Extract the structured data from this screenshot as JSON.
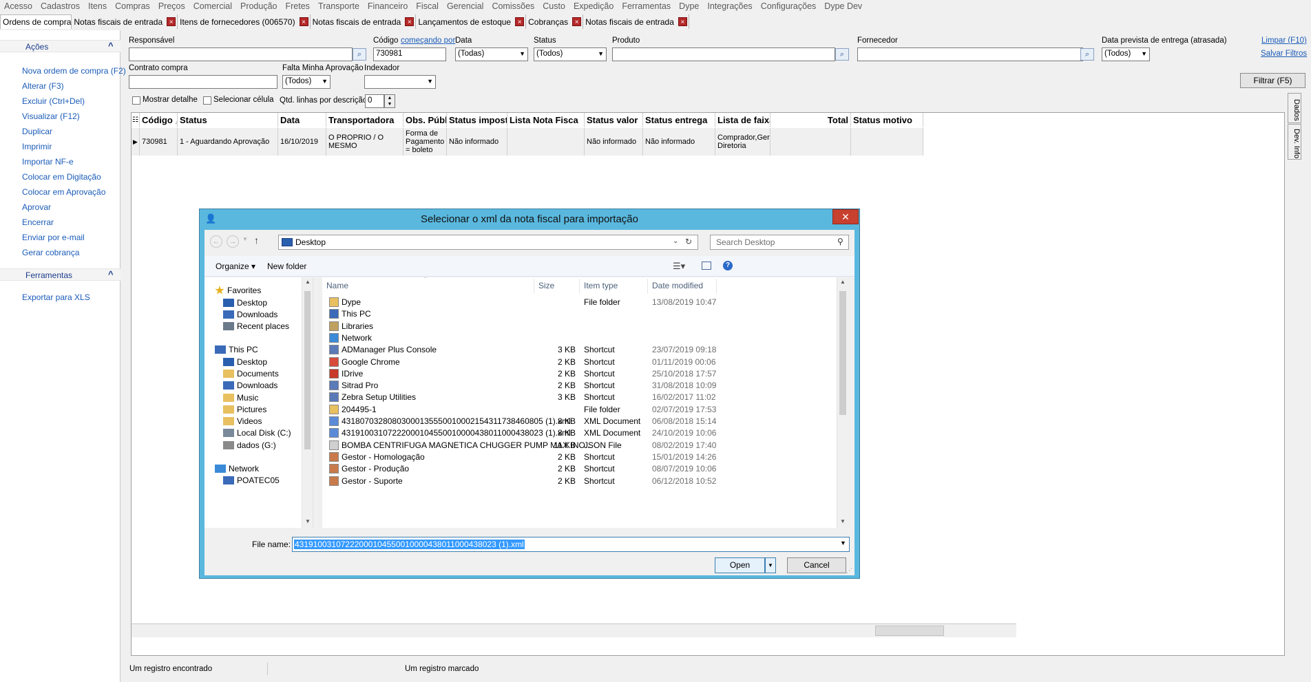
{
  "menu": [
    "Acesso",
    "Cadastros",
    "Itens",
    "Compras",
    "Preços",
    "Comercial",
    "Produção",
    "Fretes",
    "Transporte",
    "Financeiro",
    "Fiscal",
    "Gerencial",
    "Comissões",
    "Custo",
    "Expedição",
    "Ferramentas",
    "Dype",
    "Integrações",
    "Configurações",
    "Dype Dev"
  ],
  "tabs": [
    "Ordens de compra",
    "Notas fiscais de entrada",
    "Itens de fornecedores (006570)",
    "Notas fiscais de entrada",
    "Lançamentos de estoque",
    "Cobranças",
    "Notas fiscais de entrada"
  ],
  "tab_close": "×",
  "left": {
    "acoes_title": "Ações",
    "actions": [
      "Nova ordem de compra (F2)",
      "Alterar (F3)",
      "Excluir (Ctrl+Del)",
      "Visualizar (F12)",
      "Duplicar",
      "Imprimir",
      "Importar NF-e",
      "Colocar em Digitação",
      "Colocar em Aprovação",
      "Aprovar",
      "Encerrar",
      "Enviar por e-mail",
      "Gerar cobrança"
    ],
    "ferramentas_title": "Ferramentas",
    "tools": [
      "Exportar para XLS"
    ],
    "collapse": "^"
  },
  "filters": {
    "responsavel_label": "Responsável",
    "codigo_label": "Código",
    "codigo_mode": "começando por",
    "codigo_value": "730981",
    "data_label": "Data",
    "data_value": "(Todas)",
    "status_label": "Status",
    "status_value": "(Todos)",
    "produto_label": "Produto",
    "fornecedor_label": "Fornecedor",
    "entrega_label": "Data prevista de entrega (atrasada)",
    "entrega_value": "(Todos)",
    "limpar": "Limpar (F10)",
    "salvar": "Salvar Filtros",
    "contrato_label": "Contrato compra",
    "falta_label": "Falta Minha Aprovação",
    "falta_value": "(Todos)",
    "indexador_label": "Indexador",
    "indexador_value": "",
    "filtrar": "Filtrar (F5)",
    "mostrar_detalhe": "Mostrar detalhe",
    "selecionar_celula": "Selecionar célula",
    "qtd_label": "Qtd. linhas por descrição",
    "qtd_value": "0"
  },
  "grid": {
    "headers": [
      "Código",
      "Status",
      "Data",
      "Transportadora",
      "Obs. Pública",
      "Status imposto",
      "Lista Nota Fisca",
      "Status valor",
      "Status entrega",
      "Lista de faixa d",
      "Total",
      "Status motivo"
    ],
    "sort_indicator": "△",
    "row": [
      "730981",
      "1 - Aguardando Aprovação",
      "16/10/2019",
      "O PROPRIO / O MESMO",
      "Forma de Pagamento = boleto",
      "Não informado",
      "",
      "Não informado",
      "Não informado",
      "Comprador,Gerente, Diretoria",
      "",
      ""
    ]
  },
  "status_bar": {
    "left": "Um registro encontrado",
    "right": "Um registro marcado"
  },
  "side_tabs": [
    "Dados",
    "Dev. Info"
  ],
  "dialog": {
    "title": "Selecionar o xml da nota fiscal para importação",
    "close": "✕",
    "address": "Desktop",
    "search_placeholder": "Search Desktop",
    "organize": "Organize ▾",
    "new_folder": "New folder",
    "nav": [
      "Favorites",
      "Desktop",
      "Downloads",
      "Recent places",
      "This PC",
      "Desktop",
      "Documents",
      "Downloads",
      "Music",
      "Pictures",
      "Videos",
      "Local Disk (C:)",
      "dados (G:)",
      "Network",
      "POATEC05"
    ],
    "columns": [
      "Name",
      "Size",
      "Item type",
      "Date modified"
    ],
    "files": [
      {
        "name": "Dype",
        "size": "",
        "type": "File folder",
        "date": "13/08/2019 10:47",
        "icon": "folder-icon"
      },
      {
        "name": "This PC",
        "size": "",
        "type": "",
        "date": "",
        "icon": "computer-icon"
      },
      {
        "name": "Libraries",
        "size": "",
        "type": "",
        "date": "",
        "icon": "library-icon"
      },
      {
        "name": "Network",
        "size": "",
        "type": "",
        "date": "",
        "icon": "network-icon"
      },
      {
        "name": "ADManager Plus Console",
        "size": "3 KB",
        "type": "Shortcut",
        "date": "23/07/2019 09:18",
        "icon": "shortcut-icon"
      },
      {
        "name": "Google Chrome",
        "size": "2 KB",
        "type": "Shortcut",
        "date": "01/11/2019 00:06",
        "icon": "chrome-icon"
      },
      {
        "name": "IDrive",
        "size": "2 KB",
        "type": "Shortcut",
        "date": "25/10/2018 17:57",
        "icon": "idrive-icon"
      },
      {
        "name": "Sitrad Pro",
        "size": "2 KB",
        "type": "Shortcut",
        "date": "31/08/2018 10:09",
        "icon": "shortcut-icon"
      },
      {
        "name": "Zebra Setup Utilities",
        "size": "3 KB",
        "type": "Shortcut",
        "date": "16/02/2017 11:02",
        "icon": "shortcut-icon"
      },
      {
        "name": "204495-1",
        "size": "",
        "type": "File folder",
        "date": "02/07/2019 17:53",
        "icon": "folder-icon"
      },
      {
        "name": "43180703280803000135550010002154311738460805 (1).xml",
        "size": "8 KB",
        "type": "XML Document",
        "date": "06/08/2018 15:14",
        "icon": "xml-icon"
      },
      {
        "name": "43191003107222000104550010000438011000438023 (1).xml",
        "size": "8 KB",
        "type": "XML Document",
        "date": "24/10/2019 10:06",
        "icon": "xml-icon"
      },
      {
        "name": "BOMBA CENTRIFUGA MAGNETICA CHUGGER PUMP MAX INO...",
        "size": "11 KB",
        "type": "JSON File",
        "date": "08/02/2019 17:40",
        "icon": "file-icon"
      },
      {
        "name": "Gestor - Homologação",
        "size": "2 KB",
        "type": "Shortcut",
        "date": "15/01/2019 14:26",
        "icon": "user-icon"
      },
      {
        "name": "Gestor - Produção",
        "size": "2 KB",
        "type": "Shortcut",
        "date": "08/07/2019 10:06",
        "icon": "user-icon"
      },
      {
        "name": "Gestor - Suporte",
        "size": "2 KB",
        "type": "Shortcut",
        "date": "06/12/2018 10:52",
        "icon": "user-icon"
      }
    ],
    "filename_label": "File name:",
    "filename_value": "43191003107222000104550010000438011000438023 (1).xml",
    "open": "Open",
    "cancel": "Cancel"
  },
  "colors": {
    "dialog_frame": "#5ab8de",
    "link": "#1a5bb8",
    "close_red": "#c8402e",
    "selection": "#3399ff",
    "tab_close": "#b52828"
  }
}
